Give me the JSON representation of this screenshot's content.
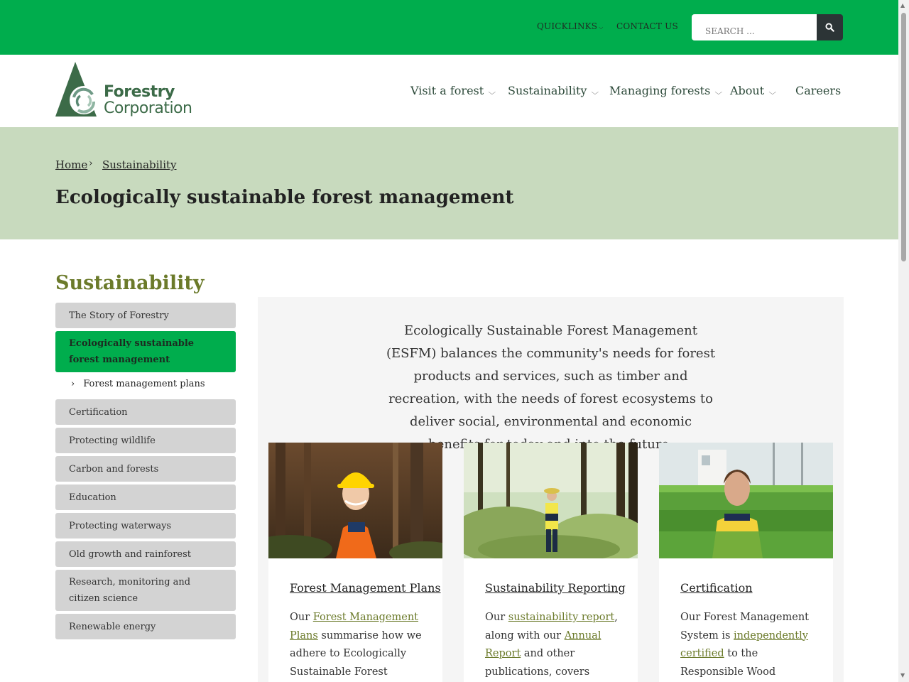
{
  "topbar": {
    "quicklinks": "QUICKLINKS",
    "contact": "CONTACT US",
    "search_placeholder": "SEARCH ...",
    "search_icon": "search-icon"
  },
  "logo": {
    "line1": "Forestry",
    "line2": "Corporation"
  },
  "nav": [
    {
      "label": "Visit a forest"
    },
    {
      "label": "Sustainability"
    },
    {
      "label": "Managing forests"
    },
    {
      "label": "About"
    },
    {
      "label": "Careers"
    }
  ],
  "breadcrumb": {
    "home": "Home",
    "section": "Sustainability"
  },
  "page_title": "Ecologically sustainable forest management",
  "sidebar": {
    "title": "Sustainability",
    "items": [
      "The Story of Forestry",
      "Ecologically sustainable forest management",
      "Certification",
      "Protecting wildlife",
      "Carbon and forests",
      "Education",
      "Protecting waterways",
      "Old growth and rainforest",
      "Research, monitoring and citizen science",
      "Renewable energy"
    ],
    "sub_item": "Forest management plans"
  },
  "intro": "Ecologically Sustainable Forest Management (ESFM) balances the community's needs for forest products and services, such as timber and recreation, with the needs of forest ecosystems to deliver social, environmental and economic benefits for today and into the future.",
  "cards": [
    {
      "title": "Forest Management Plans",
      "body_pre": "Our ",
      "link1": "Forest Management Plans",
      "body_mid": " summarise how we adhere to Ecologically Sustainable Forest",
      "link2": "",
      "body_post": ""
    },
    {
      "title": "Sustainability Reporting",
      "body_pre": "Our ",
      "link1": "sustainability report",
      "body_mid": ", along with our ",
      "link2": "Annual Report",
      "body_post": " and other publications, covers"
    },
    {
      "title": "Certification",
      "body_pre": "Our Forest Management System is ",
      "link1": "independently certified",
      "body_mid": " to the Responsible Wood Standard",
      "link2": "",
      "body_post": ""
    }
  ]
}
